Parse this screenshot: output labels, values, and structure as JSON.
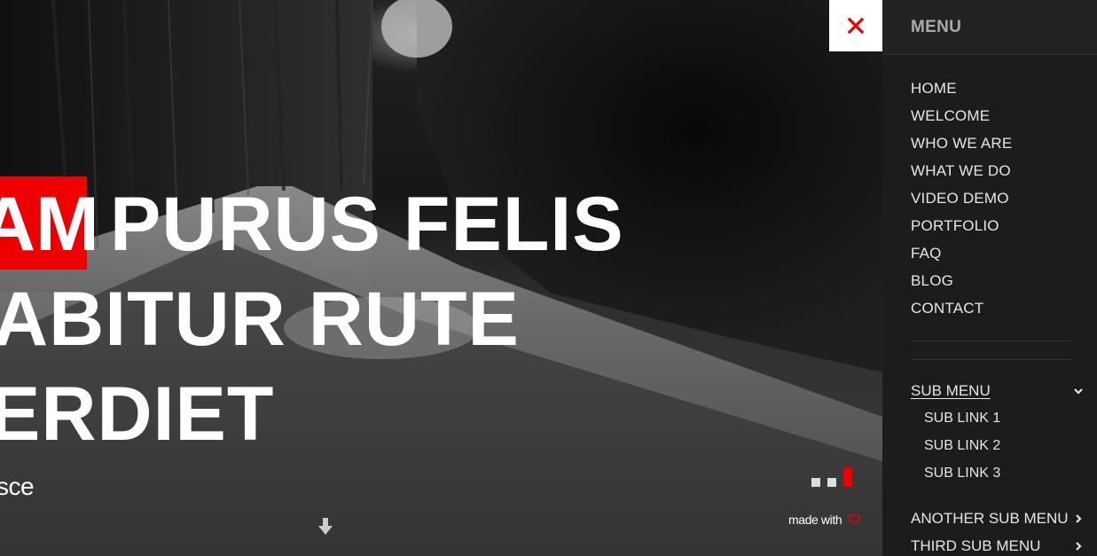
{
  "hero": {
    "headline": {
      "line1_highlight": "AM",
      "line1_rest": "PURUS FELIS",
      "line2": "ABITUR RUTE",
      "line3": "ERDIET"
    },
    "subtext": "sce",
    "made_with": "made with",
    "slides": {
      "count": 3,
      "active_index": 2
    }
  },
  "colors": {
    "accent": "#ee0000",
    "panel": "#1c1c1c",
    "text": "#e6e6e6"
  },
  "icons": {
    "close": "close-icon",
    "scroll_down": "arrow-down-icon",
    "heart": "heart-icon",
    "chevron_down": "chevron-down-icon",
    "chevron_right": "chevron-right-icon"
  },
  "menu": {
    "title": "MENU",
    "items": [
      {
        "label": "HOME"
      },
      {
        "label": "WELCOME"
      },
      {
        "label": "WHO WE ARE"
      },
      {
        "label": "WHAT WE DO"
      },
      {
        "label": "VIDEO DEMO"
      },
      {
        "label": "PORTFOLIO"
      },
      {
        "label": "FAQ"
      },
      {
        "label": "BLOG"
      },
      {
        "label": "CONTACT"
      }
    ],
    "submenu": {
      "label": "SUB MENU",
      "links": [
        {
          "label": "SUB LINK 1"
        },
        {
          "label": "SUB LINK 2"
        },
        {
          "label": "SUB LINK 3"
        }
      ]
    },
    "another_submenu": "ANOTHER SUB MENU",
    "third_submenu": "THIRD SUB MENU"
  }
}
